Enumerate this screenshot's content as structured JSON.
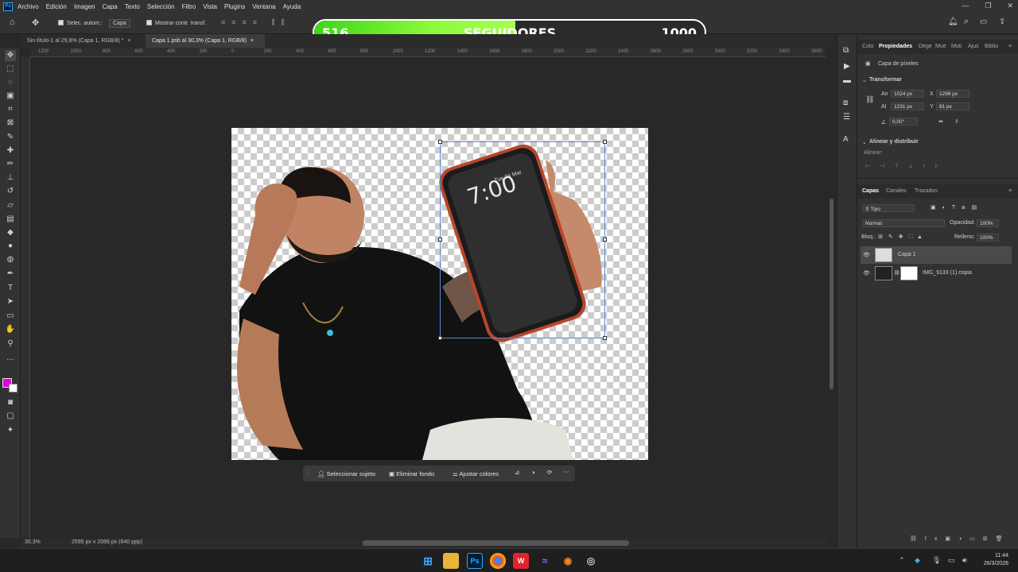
{
  "app": {
    "logo": "Ps"
  },
  "menu": [
    "Archivo",
    "Edición",
    "Imagen",
    "Capa",
    "Texto",
    "Selección",
    "Filtro",
    "Vista",
    "Plugins",
    "Ventana",
    "Ayuda"
  ],
  "options": {
    "auto_select_label": "Selec. autom.:",
    "auto_select_value": "Capa",
    "transform_label": "Mostrar contr. transf."
  },
  "followers": {
    "current": "516",
    "label": "SEGUIDORES",
    "goal": "1000",
    "progress": 0.516
  },
  "tabs": [
    {
      "label": "Sin título-1 al 29,8% (Capa 1, RGB/8) *",
      "active": false
    },
    {
      "label": "Capa 1.psb al 30,3% (Capa 1, RGB/8)",
      "active": true
    }
  ],
  "ruler_ticks": [
    "1200",
    "1000",
    "800",
    "600",
    "400",
    "200",
    "0",
    "200",
    "400",
    "600",
    "800",
    "1000",
    "1200",
    "1400",
    "1600",
    "1800",
    "2000",
    "2200",
    "2400",
    "2600",
    "2800",
    "3000",
    "3200",
    "3400",
    "3600"
  ],
  "phone": {
    "date": "Tue 24 Mar",
    "time": "7:00"
  },
  "context_bar": {
    "select_subject": "Seleccionar sujeto",
    "remove_bg": "Eliminar fondo",
    "adjust_colors": "Ajustar colores"
  },
  "status": {
    "zoom": "30.3%",
    "doc_size": "2595 px x 2066 px (640 ppp)"
  },
  "properties": {
    "tabs": [
      "Colo",
      "Propiedades",
      "Dege",
      "Mue",
      "Moti",
      "Ajus",
      "Biblio"
    ],
    "layer_type": "Capa de píxeles",
    "transform_title": "Transformar",
    "w_label": "An",
    "w": "1024 px",
    "h_label": "Al",
    "h": "1231 px",
    "x_label": "X",
    "x": "1298 px",
    "y_label": "Y",
    "y": "81 px",
    "angle": "0,00°",
    "align_title": "Alinear y distribuir",
    "align_label": "Alinear:"
  },
  "layers_panel": {
    "tabs": [
      "Capas",
      "Canales",
      "Trazados"
    ],
    "filter": "Tipo",
    "blend": "Normal",
    "opacity_label": "Opacidad:",
    "opacity": "100%",
    "lock_label": "Bloq.:",
    "fill_label": "Relleno:",
    "fill": "100%",
    "layers": [
      {
        "name": "Capa 1",
        "selected": true
      },
      {
        "name": "IMG_9133 (1) copia",
        "selected": false
      }
    ]
  },
  "clock": {
    "time": "11:44",
    "date": "26/3/2026"
  },
  "colors": {
    "accent": "#31a8ff",
    "foreground": "#e600e6",
    "progress_green": "#7df53a"
  }
}
